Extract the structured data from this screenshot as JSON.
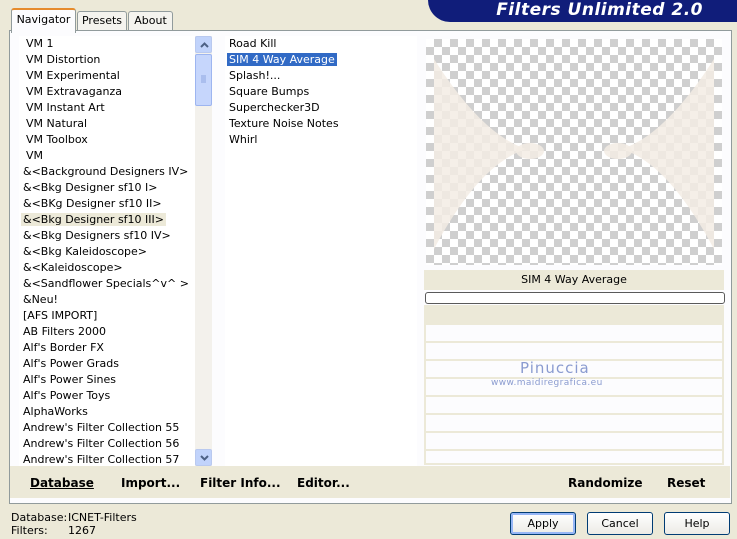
{
  "app": {
    "title": "Filters Unlimited 2.0"
  },
  "tabs": [
    {
      "label": "Navigator",
      "active": true
    },
    {
      "label": "Presets",
      "active": false
    },
    {
      "label": "About",
      "active": false
    }
  ],
  "categories": {
    "items": [
      "VM 1",
      "VM Distortion",
      "VM Experimental",
      "VM Extravaganza",
      "VM Instant Art",
      "VM Natural",
      "VM Toolbox",
      "VM",
      "&<Background Designers IV>",
      "&<Bkg Designer sf10 I>",
      "&<BKg Designer sf10 II>",
      "&<Bkg Designer sf10 III>",
      "&<Bkg Designers sf10 IV>",
      "&<Bkg Kaleidoscope>",
      "&<Kaleidoscope>",
      "&<Sandflower Specials^v^ >",
      "&Neu!",
      "[AFS IMPORT]",
      "AB Filters 2000",
      "Alf's Border FX",
      "Alf's Power Grads",
      "Alf's Power Sines",
      "Alf's Power Toys",
      "AlphaWorks",
      "Andrew's Filter Collection 55",
      "Andrew's Filter Collection 56",
      "Andrew's Filter Collection 57"
    ],
    "highlighted_index": 11
  },
  "filters": {
    "items": [
      "Road Kill",
      "SIM 4 Way Average",
      "Splash!...",
      "Square Bumps",
      "Superchecker3D",
      "Texture Noise Notes",
      "Whirl"
    ],
    "selected_index": 1
  },
  "preview": {
    "filter_name": "SIM 4 Way Average",
    "progress": 0
  },
  "watermark": {
    "line1": "Pinuccia",
    "line2": "www.maidiregrafica.eu"
  },
  "toolbar": {
    "database": "Database",
    "import": "Import...",
    "filter_info": "Filter Info...",
    "editor": "Editor...",
    "randomize": "Randomize",
    "reset": "Reset"
  },
  "status": {
    "database_label": "Database:",
    "database_value": "ICNET-Filters",
    "filters_label": "Filters:",
    "filters_value": "1267"
  },
  "buttons": {
    "apply": "Apply",
    "cancel": "Cancel",
    "help": "Help"
  },
  "colors": {
    "header_bg": "#101d7a",
    "selection": "#316ac5",
    "tab_accent": "#e68b2c"
  },
  "icons": {
    "scroll_up": "chevron-up-icon",
    "scroll_down": "chevron-down-icon"
  }
}
